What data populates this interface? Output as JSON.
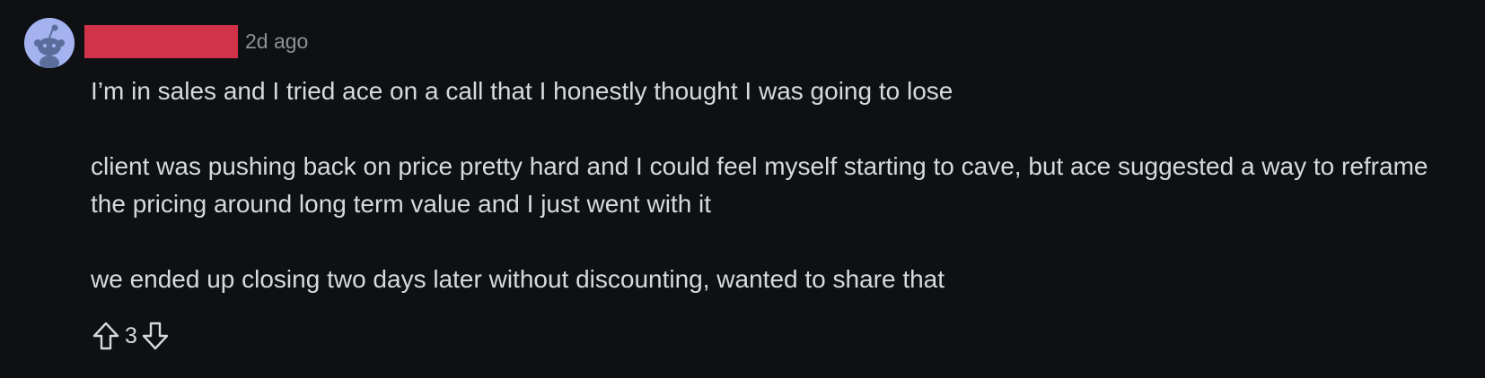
{
  "comment": {
    "username": "",
    "timestamp": "2d ago",
    "paragraphs": [
      "I’m in sales and I tried ace on a call that I honestly thought I was going to lose",
      "client was pushing back on price pretty hard and I could feel myself starting to cave, but ace suggested a way to reframe the pricing around long term value and I just went with it",
      "we ended up closing two days later without discounting, wanted to share that"
    ],
    "score": "3"
  },
  "icons": {
    "avatar": "reddit-snoo-icon",
    "upvote": "arrow-up-icon",
    "downvote": "arrow-down-icon"
  },
  "colors": {
    "background": "#0e1014",
    "text": "#d7dadc",
    "muted": "#8d9196",
    "avatar_bg": "#a4b3f0",
    "redaction": "#d1334a"
  }
}
